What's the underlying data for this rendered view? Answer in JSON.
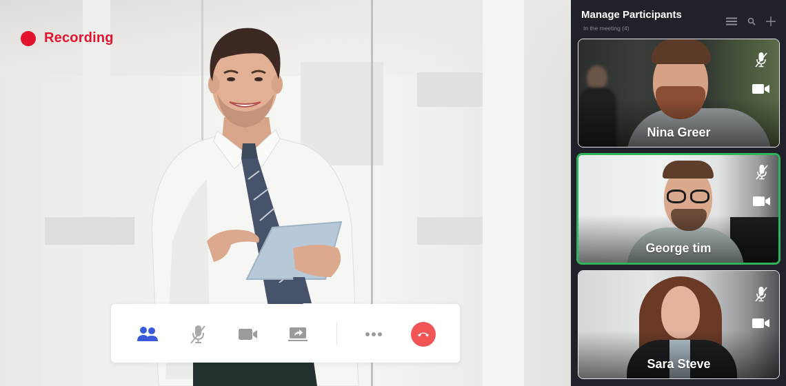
{
  "recording": {
    "label": "Recording",
    "color": "#e4132d"
  },
  "toolbar": {
    "buttons": [
      {
        "name": "participants",
        "icon": "participants-icon",
        "active": true,
        "color": "#3a5bd9"
      },
      {
        "name": "microphone",
        "icon": "microphone-muted-icon",
        "active": false
      },
      {
        "name": "camera",
        "icon": "video-camera-icon",
        "active": false
      },
      {
        "name": "share-screen",
        "icon": "share-screen-icon",
        "active": false
      },
      {
        "name": "more",
        "icon": "more-dots-icon",
        "active": false
      },
      {
        "name": "end-call",
        "icon": "end-call-icon",
        "color": "#f25555"
      }
    ]
  },
  "sidebar": {
    "title": "Manage Participants",
    "subtitle": "In the meeting (4)",
    "actions": [
      {
        "name": "list",
        "icon": "list-icon"
      },
      {
        "name": "search",
        "icon": "search-icon"
      },
      {
        "name": "add",
        "icon": "plus-icon"
      }
    ],
    "participants": [
      {
        "name": "Nina Greer",
        "mic": "muted",
        "camera": "on",
        "active": false
      },
      {
        "name": "George tim",
        "mic": "muted",
        "camera": "on",
        "active": true,
        "highlight_color": "#2fb45a"
      },
      {
        "name": "Sara Steve",
        "mic": "muted",
        "camera": "on",
        "active": false
      }
    ]
  }
}
